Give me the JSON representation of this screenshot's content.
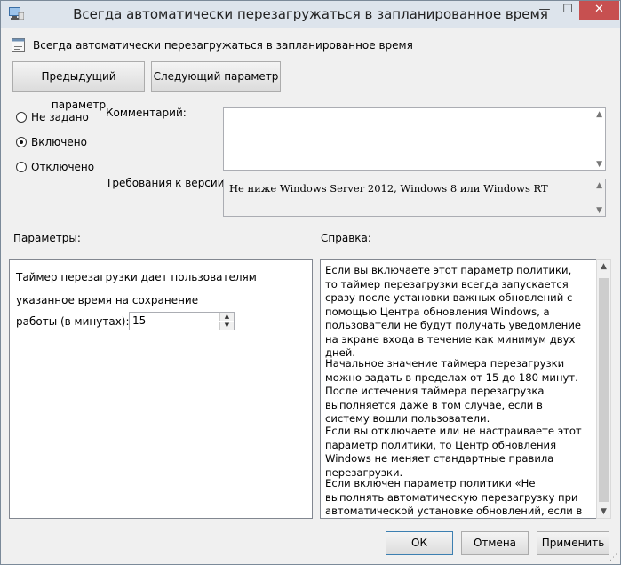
{
  "window": {
    "title": "Всегда автоматически перезагружаться в запланированное время",
    "controls": {
      "minimize": "—",
      "maximize": "☐",
      "close": "✕"
    }
  },
  "policy_name": "Всегда автоматически перезагружаться в запланированное время",
  "nav": {
    "prev_label": "Предыдущий параметр",
    "next_label": "Следующий параметр"
  },
  "state": {
    "options": [
      {
        "label": "Не задано",
        "selected": false
      },
      {
        "label": "Включено",
        "selected": true
      },
      {
        "label": "Отключено",
        "selected": false
      }
    ]
  },
  "comment": {
    "label": "Комментарий:",
    "value": ""
  },
  "requirements": {
    "label": "Требования к версии:",
    "value": "Не ниже Windows Server 2012, Windows 8 или Windows RT"
  },
  "params": {
    "header": "Параметры:",
    "line1": "Таймер перезагрузки дает пользователям",
    "line2": "указанное время на сохранение",
    "line3": "работы (в минутах):",
    "minutes_value": "15"
  },
  "help": {
    "header": "Справка:",
    "paragraphs": [
      "Если вы включаете этот параметр политики, то таймер перезагрузки всегда запускается сразу после установки важных обновлений с помощью Центра обновления Windows, а пользователи не будут получать уведомление на экране входа в течение как минимум двух дней.",
      "Начальное значение таймера перезагрузки можно задать в пределах от 15 до 180 минут. После истечения таймера перезагрузка выполняется даже в том случае, если в систему вошли пользователи.",
      "Если вы отключаете или не настраиваете этот параметр политики, то Центр обновления Windows не меняет стандартные правила перезагрузки.",
      "Если включен параметр политики «Не выполнять автоматическую перезагрузку при автоматической установке обновлений, если в системе работают"
    ]
  },
  "buttons": {
    "ok": "ОК",
    "cancel": "Отмена",
    "apply": "Применить"
  },
  "colors": {
    "close_button": "#c75050",
    "titlebar": "#dde4ec",
    "dialog_bg": "#f0f0f0"
  }
}
